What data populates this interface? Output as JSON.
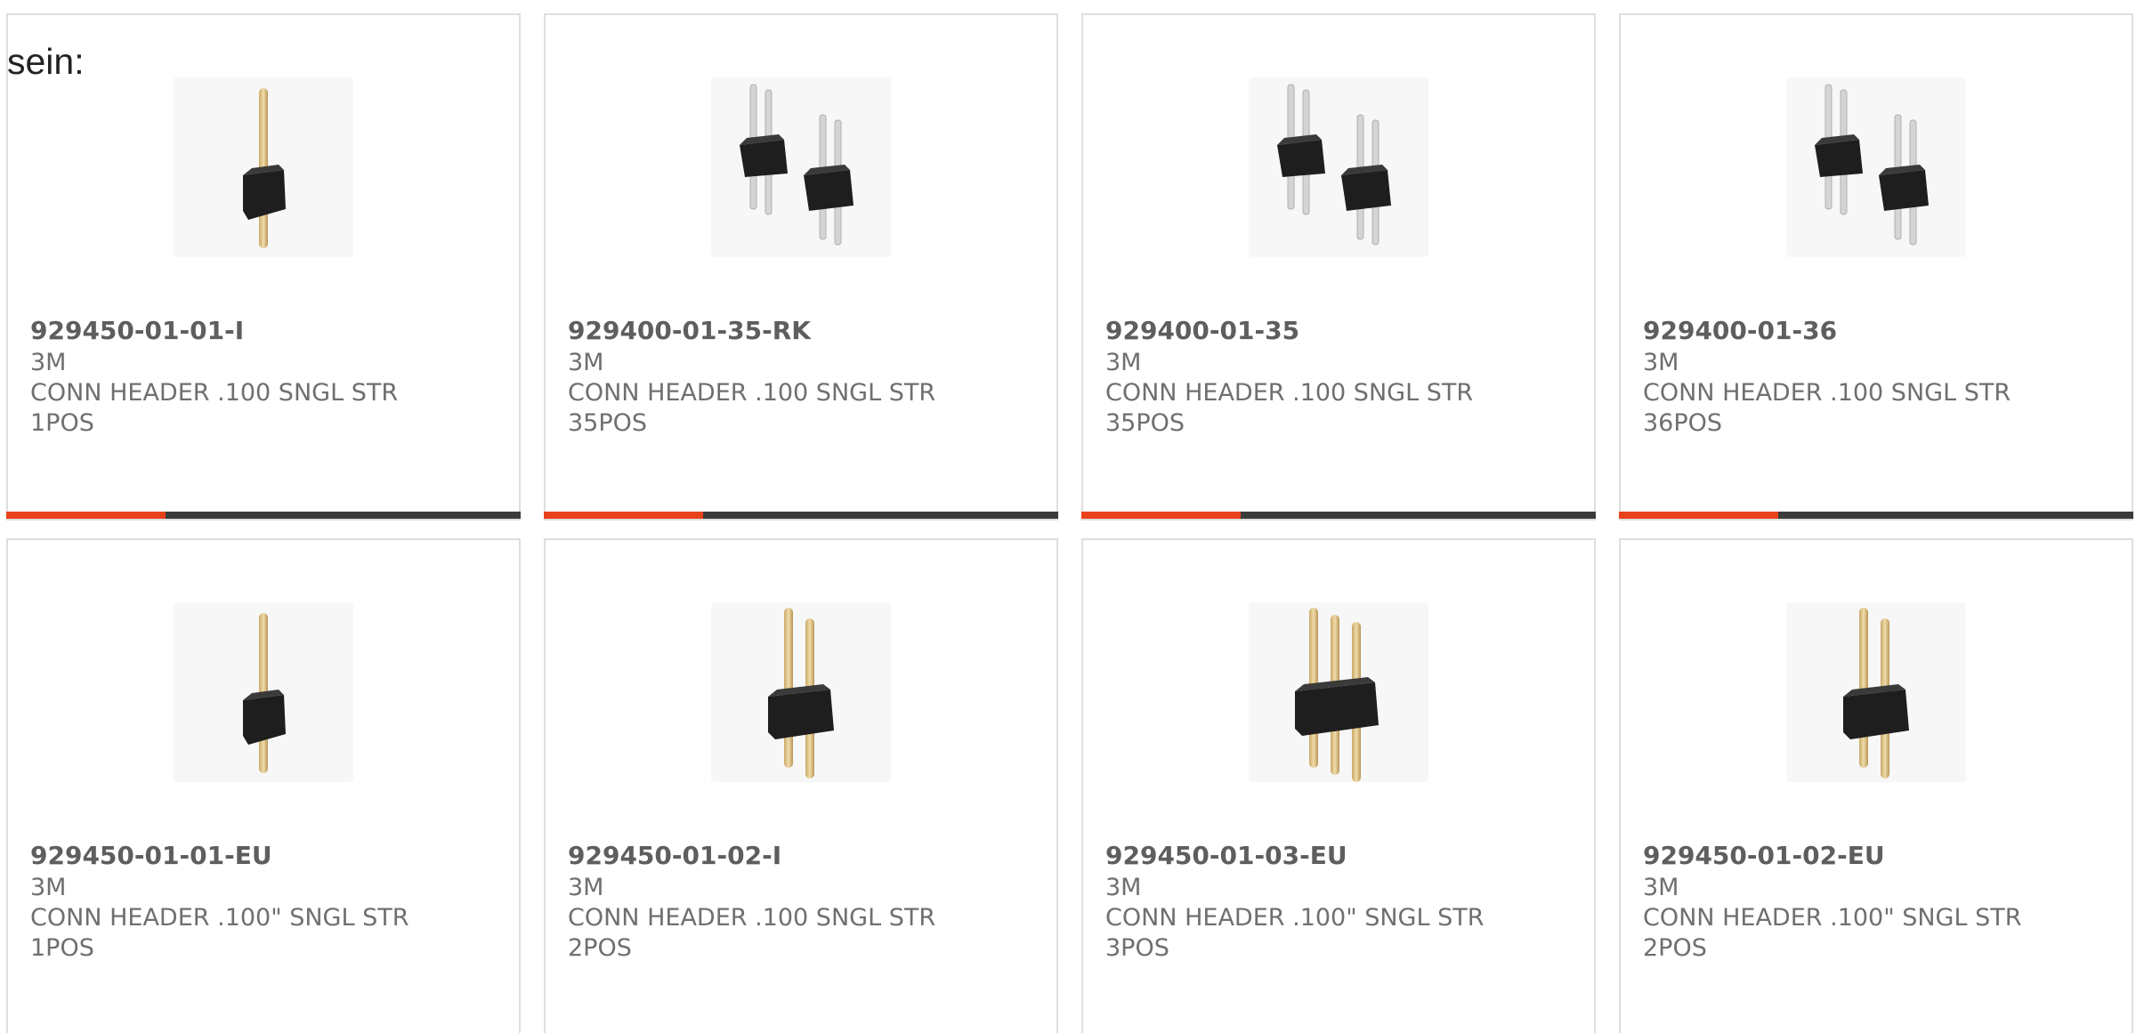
{
  "intro_text": "sein:",
  "colors": {
    "accent": "#e8421c",
    "track": "#3b3b3b",
    "card_border": "#dedede",
    "part_number": "#5e5e5e",
    "body_text": "#6f6f6f"
  },
  "products": [
    {
      "part_number": "929450-01-01-I",
      "manufacturer": "3M",
      "desc_line1": "CONN HEADER .100 SNGL STR",
      "desc_line2": "1POS",
      "image_icon": "single-pin-header-icon",
      "progress": 0.31
    },
    {
      "part_number": "929400-01-35-RK",
      "manufacturer": "3M",
      "desc_line1": "CONN HEADER .100 SNGL STR",
      "desc_line2": "35POS",
      "image_icon": "dual-header-pair-icon",
      "progress": 0.31
    },
    {
      "part_number": "929400-01-35",
      "manufacturer": "3M",
      "desc_line1": "CONN HEADER .100 SNGL STR",
      "desc_line2": "35POS",
      "image_icon": "dual-header-pair-icon",
      "progress": 0.31
    },
    {
      "part_number": "929400-01-36",
      "manufacturer": "3M",
      "desc_line1": "CONN HEADER .100 SNGL STR",
      "desc_line2": "36POS",
      "image_icon": "dual-header-pair-icon",
      "progress": 0.31
    },
    {
      "part_number": "929450-01-01-EU",
      "manufacturer": "3M",
      "desc_line1": "CONN HEADER .100\" SNGL STR",
      "desc_line2": "1POS",
      "image_icon": "single-pin-header-icon"
    },
    {
      "part_number": "929450-01-02-I",
      "manufacturer": "3M",
      "desc_line1": "CONN HEADER .100 SNGL STR",
      "desc_line2": "2POS",
      "image_icon": "two-pin-header-icon"
    },
    {
      "part_number": "929450-01-03-EU",
      "manufacturer": "3M",
      "desc_line1": "CONN HEADER .100\" SNGL STR",
      "desc_line2": "3POS",
      "image_icon": "three-pin-header-icon"
    },
    {
      "part_number": "929450-01-02-EU",
      "manufacturer": "3M",
      "desc_line1": "CONN HEADER .100\" SNGL STR",
      "desc_line2": "2POS",
      "image_icon": "two-pin-header-icon"
    }
  ]
}
